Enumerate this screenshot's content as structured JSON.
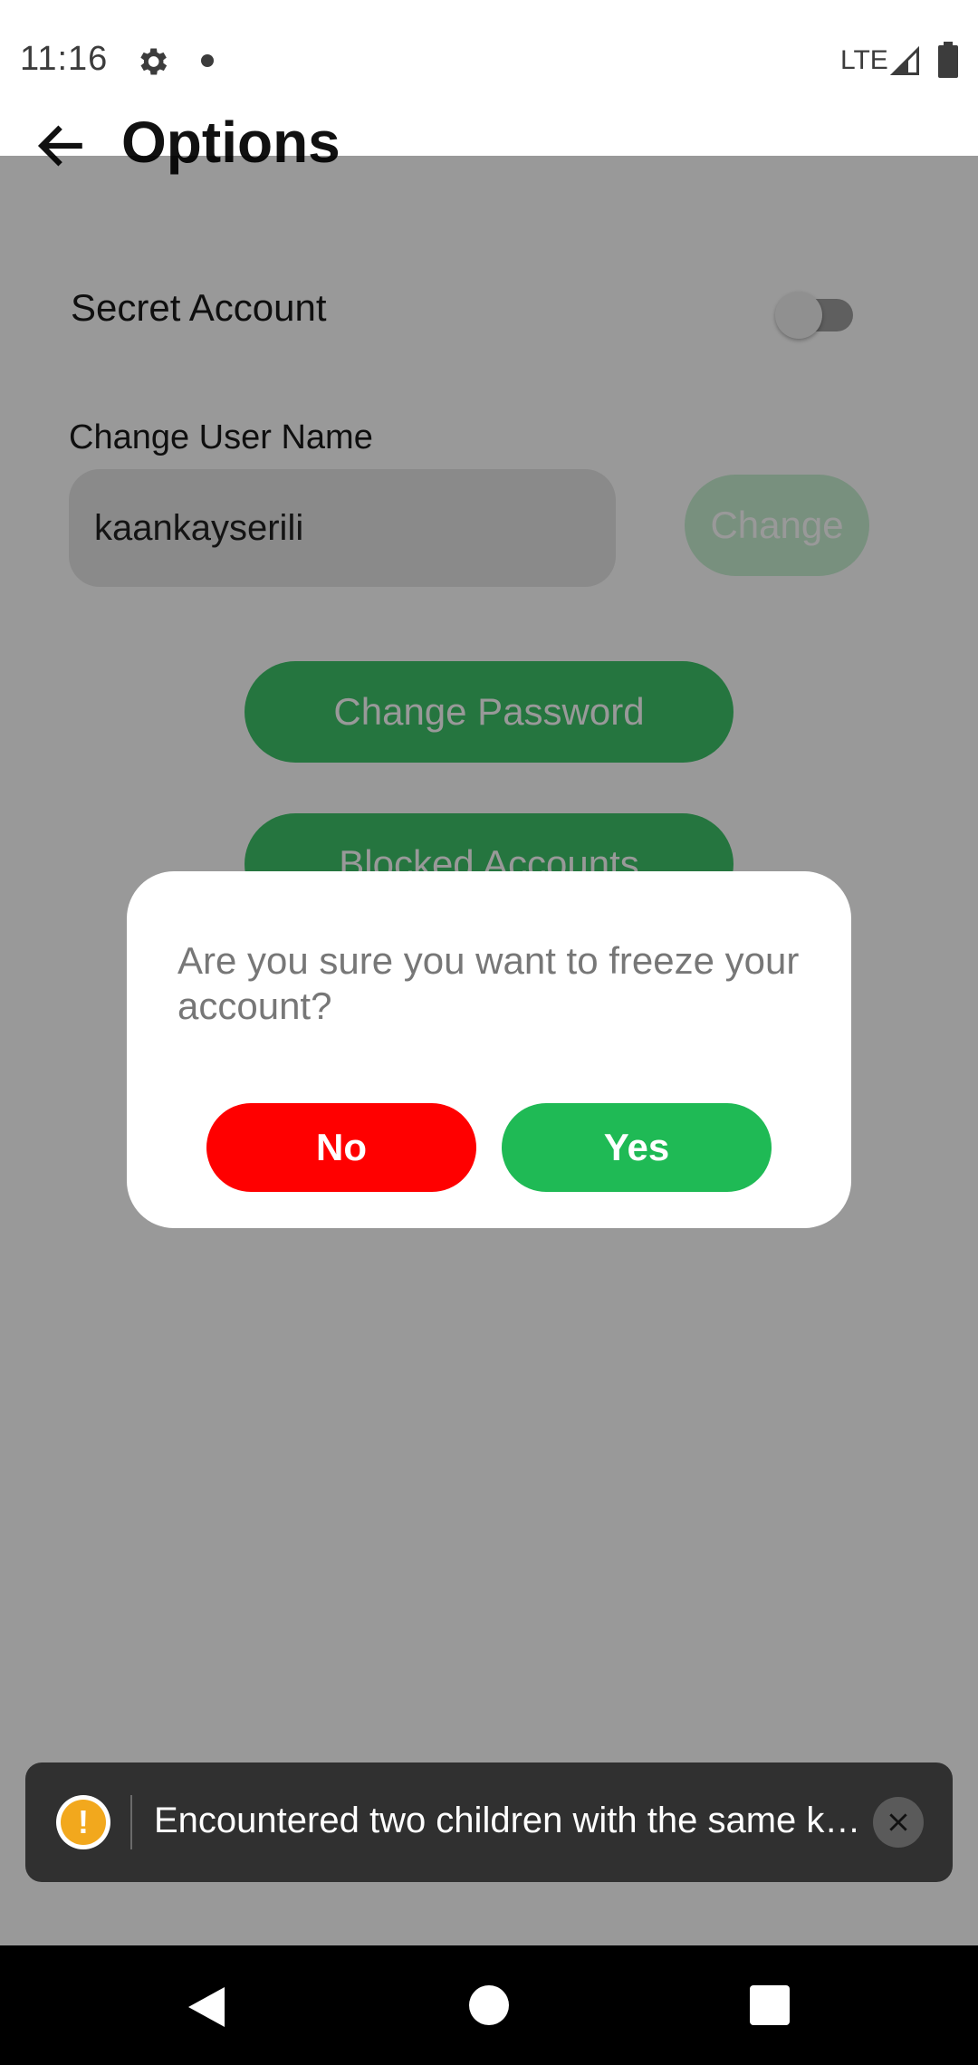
{
  "status_bar": {
    "time": "11:16",
    "network": "LTE",
    "icons": [
      "gear-icon",
      "notification-dot-icon",
      "signal-icon",
      "battery-icon"
    ]
  },
  "header": {
    "title": "Options",
    "back_icon": "arrow-back-icon"
  },
  "settings": {
    "secret_account_label": "Secret Account",
    "secret_account_enabled": false,
    "username_label": "Change User Name",
    "username_value": "kaankayserili",
    "change_button": "Change",
    "change_password_button": "Change Password",
    "blocked_accounts_button": "Blocked Accounts"
  },
  "dialog": {
    "message": "Are you sure you want to freeze your account?",
    "no_button": "No",
    "yes_button": "Yes"
  },
  "toast": {
    "icon": "warning-icon",
    "warning_symbol": "!",
    "message": "Encountered two children with the same ke…",
    "close_icon": "close-icon"
  },
  "colors": {
    "accent_green": "#3fc46a",
    "yes_green": "#1fba55",
    "no_red": "#ff0000",
    "toast_bg": "#303030",
    "warning": "#f2a81d"
  },
  "nav_bar": {
    "icons": [
      "nav-back-icon",
      "nav-home-icon",
      "nav-recents-icon"
    ]
  }
}
